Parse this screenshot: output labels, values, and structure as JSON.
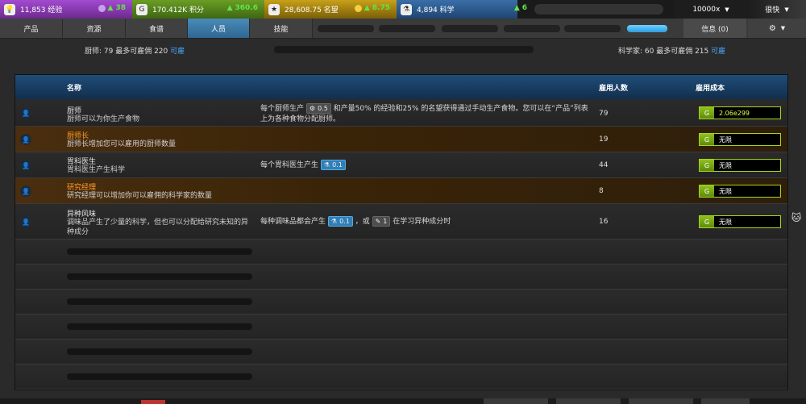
{
  "resources": [
    {
      "value": "11,853 经验",
      "increase": "38",
      "color": "#a24bd0",
      "icon": "lightbulb-icon"
    },
    {
      "value": "170.412K 积分",
      "increase": "360.6",
      "color": "#6a9d24",
      "icon": "coin-icon"
    },
    {
      "value": "28,608.75 名望",
      "increase": "8.75",
      "color": "#c8a01a",
      "icon": "star-icon"
    },
    {
      "value": "4,894 科学",
      "increase": "6",
      "color": "#3a6fa8",
      "icon": "flask-icon"
    }
  ],
  "speed": {
    "primary": "10000x",
    "secondary": "很快"
  },
  "tabs": [
    {
      "label": "产品"
    },
    {
      "label": "资源"
    },
    {
      "label": "食谱"
    },
    {
      "label": "人员",
      "active": true
    },
    {
      "label": "技能"
    }
  ],
  "info_tab": "信息 (0)",
  "status": {
    "chef": "厨师:  79 最多可雇佣 220",
    "chef_avail": "可雇",
    "sci": "科学家:  60 最多可雇佣 215",
    "sci_avail": "可雇"
  },
  "table": {
    "headers": {
      "name": "名称",
      "count": "雇用人数",
      "cost": "雇用成本"
    },
    "rows": [
      {
        "name": "厨师",
        "desc": "厨师可以为你生产食物",
        "prod_pre": "每个厨师生产",
        "chip1": "0.5",
        "prod_post": "和产量50% 的经验和25% 的名望获得通过手动生产食物。您可以在“产品”列表上为各种食物分配厨师。",
        "count": "79",
        "cost": "2.06e299"
      },
      {
        "name": "厨师长",
        "desc": "厨师长增加您可以雇用的厨师数量",
        "count": "19",
        "cost": "无限"
      },
      {
        "name": "胃科医生",
        "desc": "胃科医生产生科学",
        "prod_pre": "每个胃科医生产生",
        "chip1": "0.1",
        "count": "44",
        "cost": "无限"
      },
      {
        "name": "研究经理",
        "desc": "研究经理可以增加你可以雇佣的科学家的数量",
        "count": "8",
        "cost": "无限"
      },
      {
        "name": "异种风味",
        "desc": "调味品产生了少量的科学，但也可以分配给研究未知的异种成分",
        "prod_pre": "每种调味品都会产生",
        "chip1": "0.1",
        "mid": "，或",
        "chip2": "1",
        "prod_post": "在学习异种成分时",
        "count": "16",
        "cost": "无限"
      }
    ]
  }
}
